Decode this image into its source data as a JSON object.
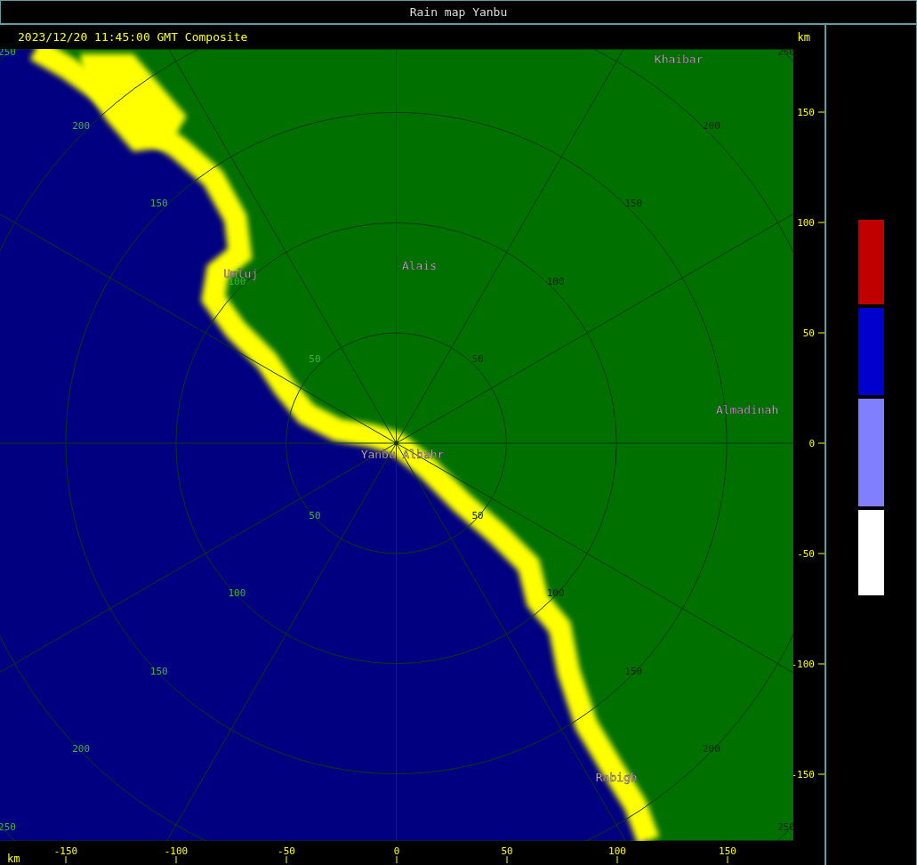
{
  "window": {
    "title": "Rain map Yanbu"
  },
  "header": {
    "timestamp": "2023/12/20 11:45:00 GMT Composite",
    "unit": "km"
  },
  "map": {
    "rings": [
      {
        "labels": [
          "50",
          "50",
          "50",
          "50"
        ]
      },
      {
        "labels": [
          "100",
          "100",
          "100",
          "100"
        ]
      },
      {
        "labels": [
          "150",
          "150",
          "150",
          "150"
        ]
      },
      {
        "labels": [
          "200",
          "200",
          "200",
          "200"
        ]
      },
      {
        "labels": [
          "250",
          "250",
          "250",
          "250"
        ]
      }
    ],
    "cities": [
      "Khaibar",
      "Alais",
      "Umluj",
      "Almadinah",
      "Yanbu Albahr",
      "Rabigh"
    ]
  },
  "y_axis": {
    "ticks": [
      "150",
      "100",
      "50",
      "0",
      "-50",
      "-100",
      "-150"
    ]
  },
  "x_axis": {
    "unit": "km",
    "ticks": [
      "-150",
      "-100",
      "-50",
      "0",
      "50",
      "100",
      "150"
    ]
  },
  "legend": [
    {
      "color": "#c00000"
    },
    {
      "color": "#0000cc"
    },
    {
      "color": "#8080ff"
    },
    {
      "color": "#ffffff"
    }
  ]
}
